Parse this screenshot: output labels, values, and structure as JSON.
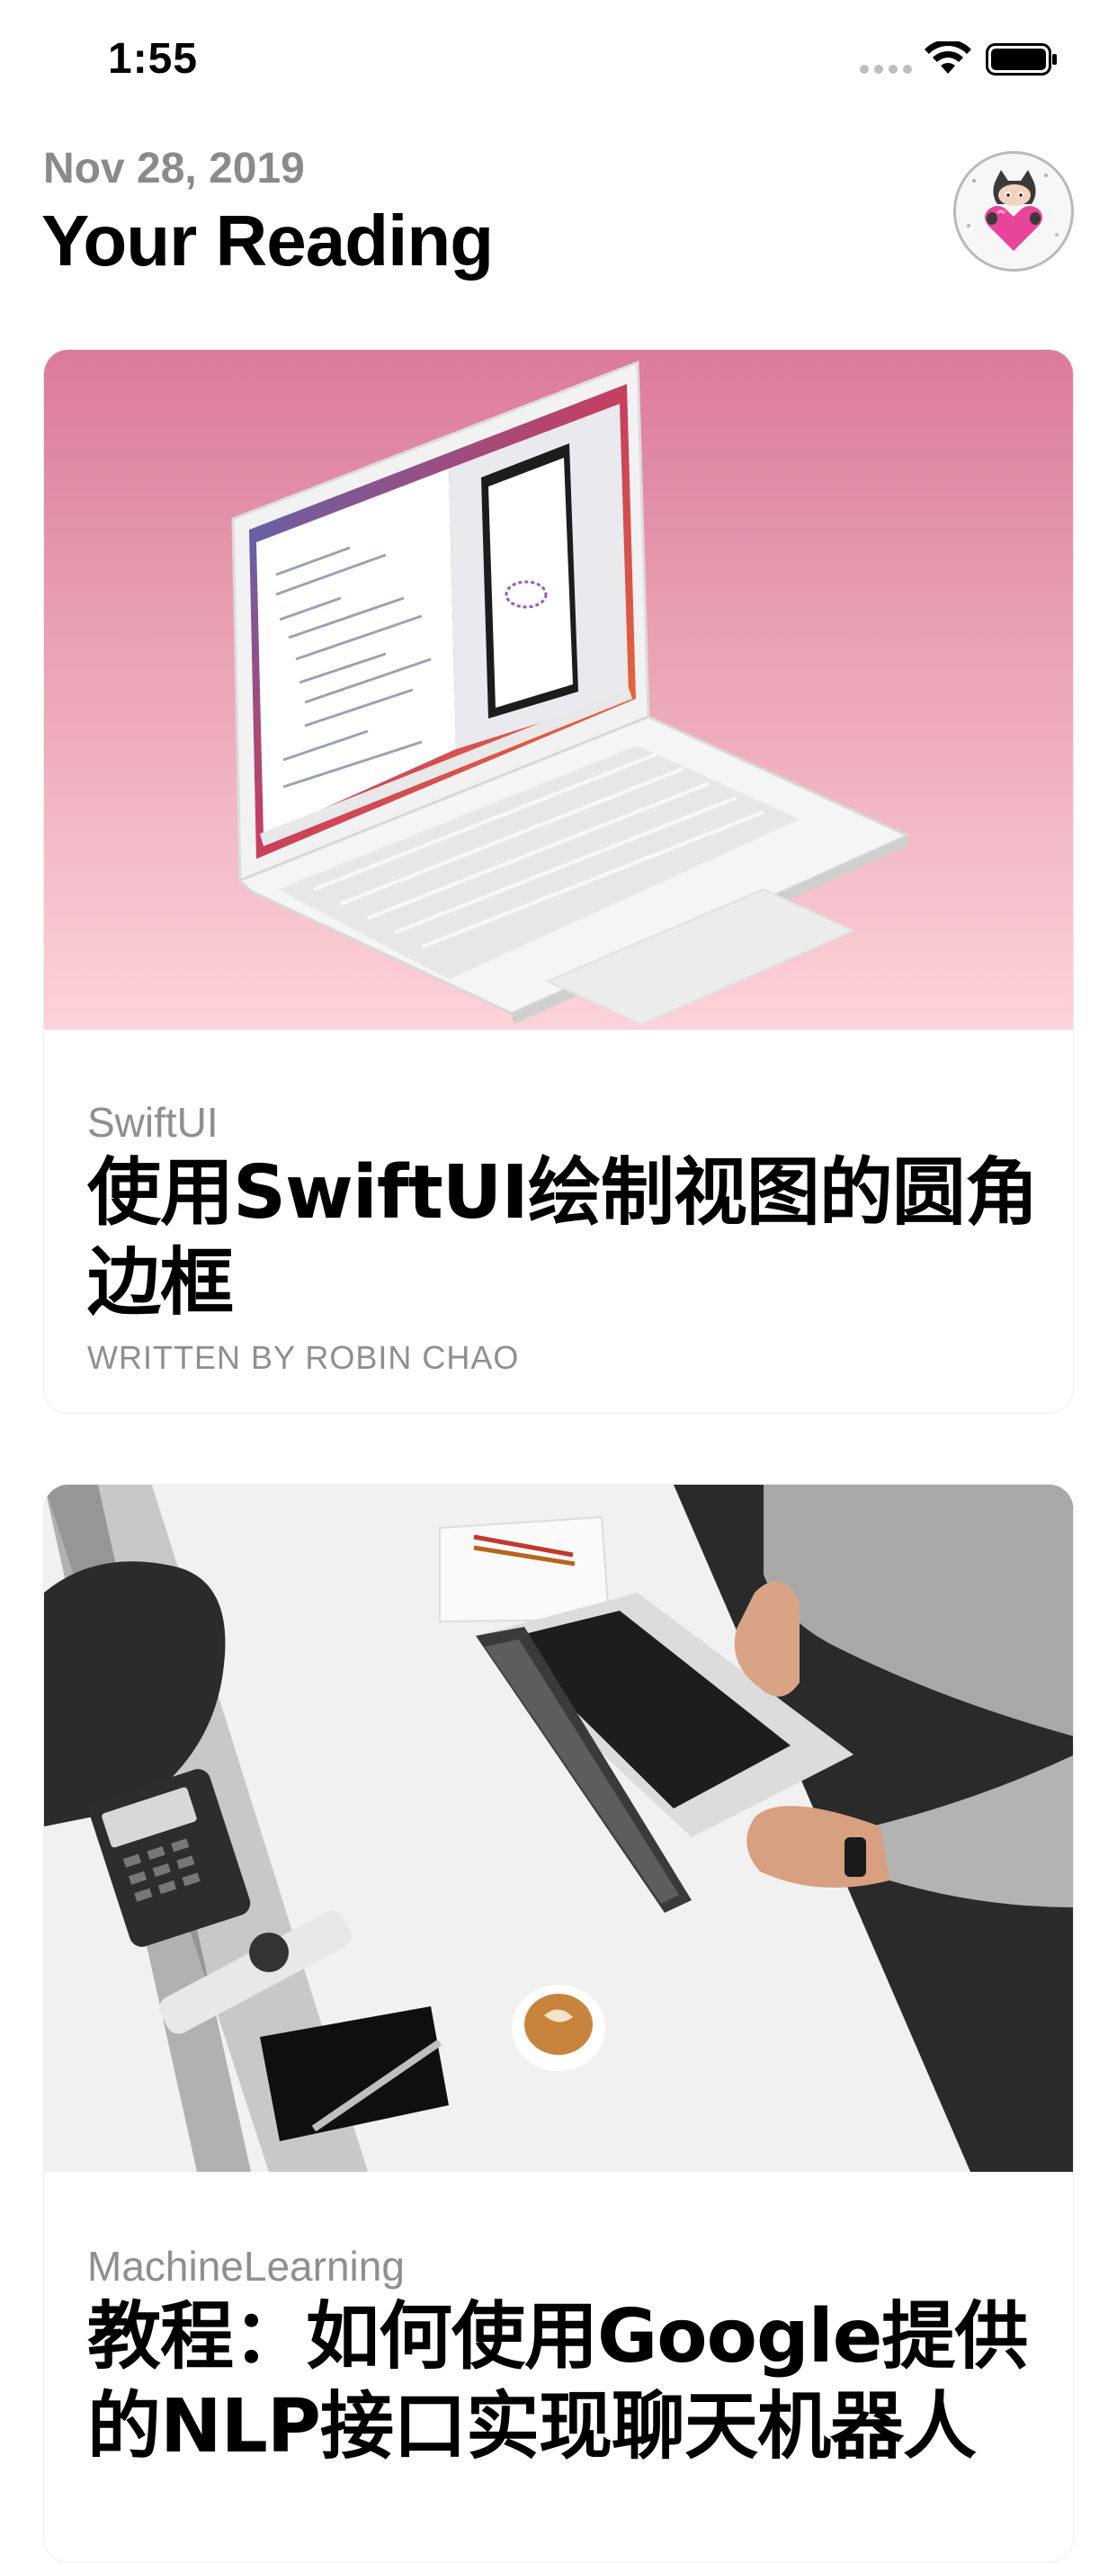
{
  "status_bar": {
    "time": "1:55"
  },
  "header": {
    "date": "Nov 28, 2019",
    "title": "Your Reading"
  },
  "articles": [
    {
      "category": "SwiftUI",
      "title": "使用SwiftUI绘制视图的圆角边框",
      "author": "WRITTEN BY ROBIN CHAO"
    },
    {
      "category": "MachineLearning",
      "title": "教程：如何使用Google提供的NLP接口实现聊天机器人"
    }
  ],
  "colors": {
    "card1_gradient_top": "#db7b9a",
    "card1_gradient_bottom": "#fdd3d9",
    "secondary_text": "#8e8e93",
    "title_text": "#000000"
  },
  "icons": {
    "signal": "cellular-signal-icon",
    "wifi": "wifi-icon",
    "battery": "battery-icon"
  }
}
